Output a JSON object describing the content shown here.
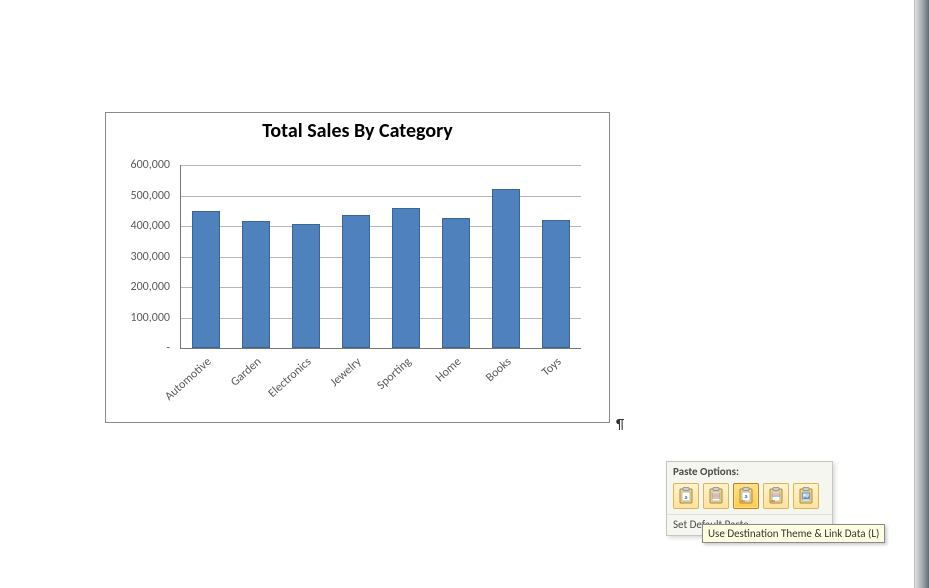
{
  "chart_data": {
    "type": "bar",
    "title": "Total Sales By Category",
    "categories": [
      "Automotive",
      "Garden",
      "Electronics",
      "Jewelry",
      "Sporting",
      "Home",
      "Books",
      "Toys"
    ],
    "values": [
      450000,
      415000,
      405000,
      435000,
      460000,
      425000,
      520000,
      420000
    ],
    "ylim": [
      0,
      600000
    ],
    "y_ticks": [
      "-",
      "100,000",
      "200,000",
      "300,000",
      "400,000",
      "500,000",
      "600,000"
    ],
    "bar_color": "#4f81bd"
  },
  "document": {
    "paragraph_mark": "¶"
  },
  "paste_popup": {
    "header": "Paste Options:",
    "default_label": "Set Default Paste...",
    "options": [
      {
        "name": "use-destination-theme-embed",
        "selected": false
      },
      {
        "name": "keep-source-formatting-embed",
        "selected": false
      },
      {
        "name": "use-destination-theme-link",
        "selected": true
      },
      {
        "name": "keep-source-formatting-link",
        "selected": false
      },
      {
        "name": "picture",
        "selected": false
      }
    ]
  },
  "tooltip": {
    "text": "Use Destination Theme & Link Data (L)"
  }
}
